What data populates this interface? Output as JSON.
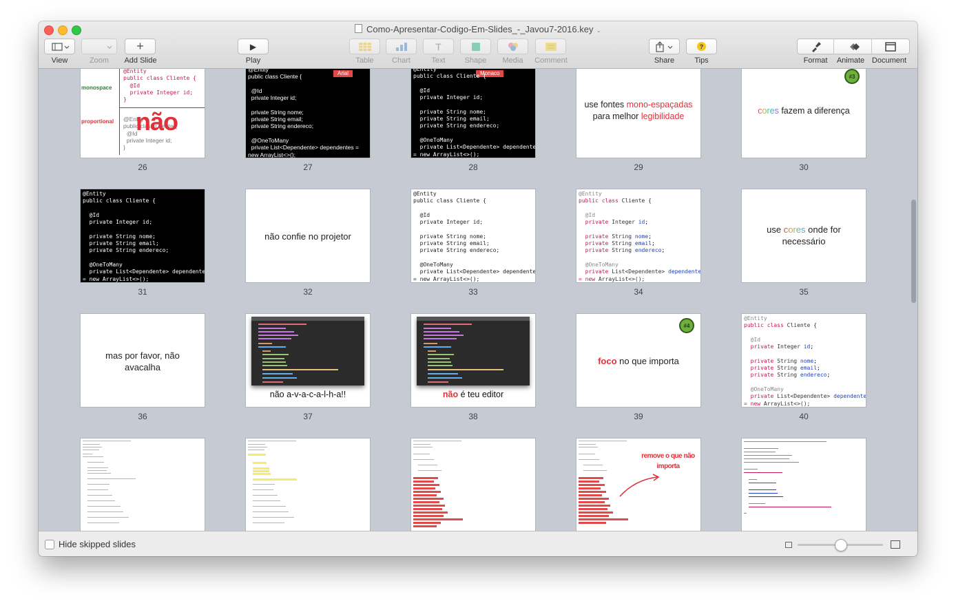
{
  "window": {
    "title": "Como-Apresentar-Codigo-Em-Slides_-_Javou7-2016.key",
    "title_chevron": "⌄"
  },
  "toolbar": {
    "view_label": "View",
    "zoom_label": "Zoom",
    "add_slide_label": "Add Slide",
    "add_slide_glyph": "+",
    "play_label": "Play",
    "play_glyph": "▶",
    "table_label": "Table",
    "chart_label": "Chart",
    "text_label": "Text",
    "text_glyph": "T",
    "shape_label": "Shape",
    "media_label": "Media",
    "comment_label": "Comment",
    "share_label": "Share",
    "tips_label": "Tips",
    "tips_glyph": "?",
    "format_label": "Format",
    "animate_label": "Animate",
    "document_label": "Document"
  },
  "colors": {
    "accent_red": "#e0303a",
    "badge_green": "#6fb03c",
    "keyword": "#c2185b",
    "identifier": "#1a3fc7",
    "background": "#c5cad3"
  },
  "slides": {
    "s26": {
      "number": "26",
      "monospace_label": "monospace",
      "proportional_label": "proportional",
      "mono_code": "@Entity\npublic class Cliente {\n  @Id\n  private Integer id;\n}",
      "prop_code": "@Entity\npublic class Cliente {\n  @Id\n  private Integer id;\n}",
      "overlay": "não"
    },
    "s27": {
      "number": "27",
      "tag": "Arial",
      "code": "@Entity\npublic class Cliente {\n\n  @Id\n  private Integer id;\n\n  private String nome;\n  private String email;\n  private String endereco;\n\n  @OneToMany\n  private List<Dependente> dependentes =\nnew ArrayList<>();"
    },
    "s28": {
      "number": "28",
      "tag": "Monaco",
      "code": "@Entity\npublic class Cliente {\n\n  @Id\n  private Integer id;\n\n  private String nome;\n  private String email;\n  private String endereco;\n\n  @OneToMany\n  private List<Dependente> dependentes\n= new ArrayList<>();"
    },
    "s29": {
      "number": "29",
      "text_a": "use fontes ",
      "text_b": "mono-espaçadas",
      "text_c": "para melhor ",
      "text_d": "legibilidade"
    },
    "s30": {
      "number": "30",
      "badge": "#3",
      "word_colored": "cores",
      "rest": " fazem a diferença"
    },
    "s31": {
      "number": "31",
      "code": "@Entity\npublic class Cliente {\n\n  @Id\n  private Integer id;\n\n  private String nome;\n  private String email;\n  private String endereco;\n\n  @OneToMany\n  private List<Dependente> dependentes\n= new ArrayList<>();"
    },
    "s32": {
      "number": "32",
      "text": "não confie no projetor"
    },
    "s33": {
      "number": "33",
      "code": "@Entity\npublic class Cliente {\n\n  @Id\n  private Integer id;\n\n  private String nome;\n  private String email;\n  private String endereco;\n\n  @OneToMany\n  private List<Dependente> dependentes\n= new ArrayList<>();"
    },
    "s34": {
      "number": "34"
    },
    "s35": {
      "number": "35",
      "text_a": "use ",
      "word_colored": "cores",
      "text_b": " onde for",
      "text_c": "necessário"
    },
    "s36": {
      "number": "36",
      "line1": "mas por favor, não",
      "line2": "avacalha"
    },
    "s37": {
      "number": "37",
      "caption": "não a-v-a-c-a-l-h-a!!"
    },
    "s38": {
      "number": "38",
      "caption_red": "não",
      "caption_rest": " é teu editor"
    },
    "s39": {
      "number": "39",
      "badge": "#4",
      "word_red": "foco",
      "rest": " no que importa"
    },
    "s40": {
      "number": "40"
    },
    "s44": {
      "line1": "remove o que não",
      "line2": "importa"
    }
  },
  "bottom": {
    "hide_skipped_label": "Hide skipped slides"
  }
}
